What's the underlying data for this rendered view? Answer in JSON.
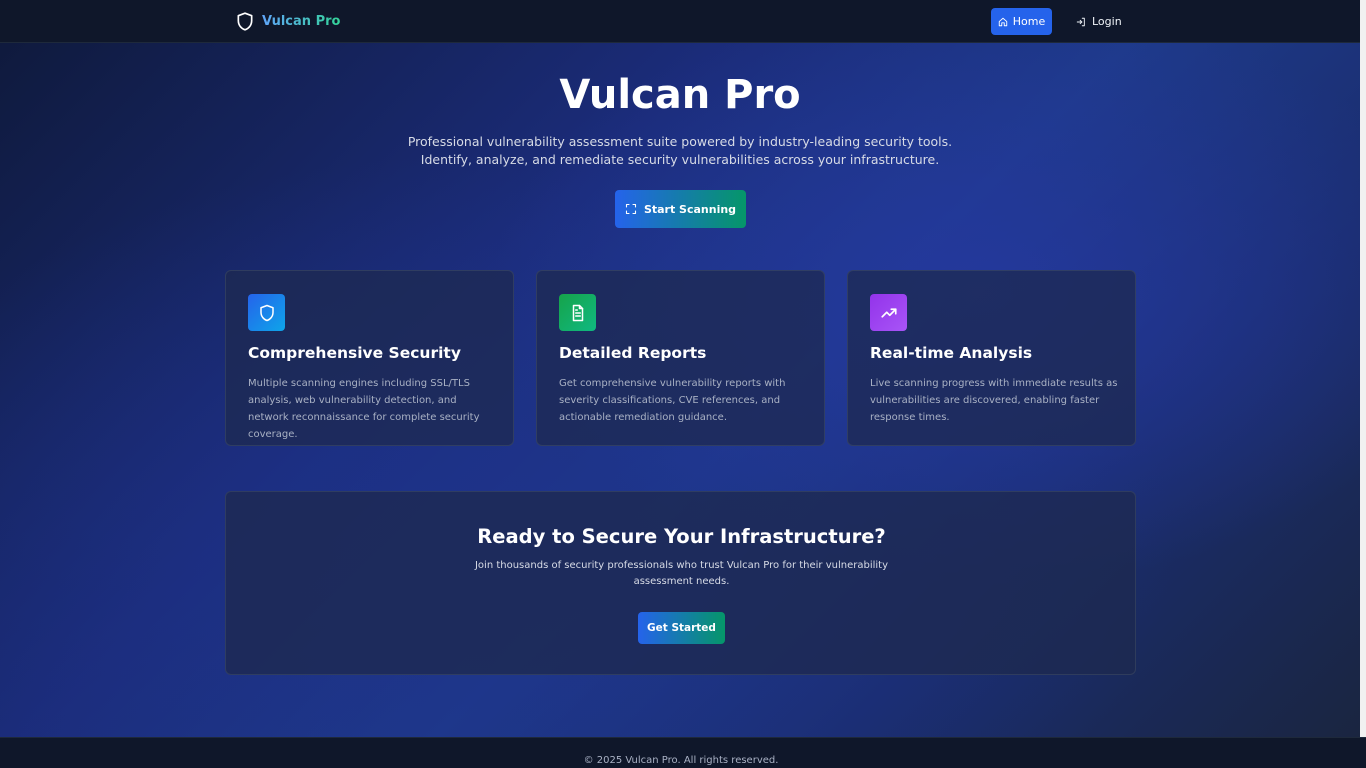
{
  "nav": {
    "brand": "Vulcan Pro",
    "brand_icon": "shield-icon",
    "items": [
      {
        "label": "Home",
        "icon": "home-icon",
        "active": true
      },
      {
        "label": "Login",
        "icon": "login-icon",
        "active": false
      }
    ]
  },
  "hero": {
    "title": "Vulcan Pro",
    "subtitle": "Professional vulnerability assessment suite powered by industry-leading security tools. Identify, analyze, and remediate security vulnerabilities across your infrastructure.",
    "cta_label": "Start Scanning",
    "cta_icon": "scan-icon"
  },
  "features": [
    {
      "icon": "shield-icon",
      "icon_color": "#2563eb",
      "title": "Comprehensive Security",
      "description": "Multiple scanning engines including SSL/TLS analysis, web vulnerability detection, and network reconnaissance for complete security coverage."
    },
    {
      "icon": "document-icon",
      "icon_color": "#16a34a",
      "title": "Detailed Reports",
      "description": "Get comprehensive vulnerability reports with severity classifications, CVE references, and actionable remediation guidance."
    },
    {
      "icon": "trending-up-icon",
      "icon_color": "#9333ea",
      "title": "Real-time Analysis",
      "description": "Live scanning progress with immediate results as vulnerabilities are discovered, enabling faster response times."
    }
  ],
  "cta_section": {
    "title": "Ready to Secure Your Infrastructure?",
    "subtitle": "Join thousands of security professionals who trust Vulcan Pro for their vulnerability assessment needs.",
    "button_label": "Get Started"
  },
  "footer": {
    "text": "© 2025 Vulcan Pro. All rights reserved."
  },
  "colors": {
    "accent_blue": "#2563eb",
    "accent_green": "#059669",
    "nav_bg": "#0f172a"
  }
}
